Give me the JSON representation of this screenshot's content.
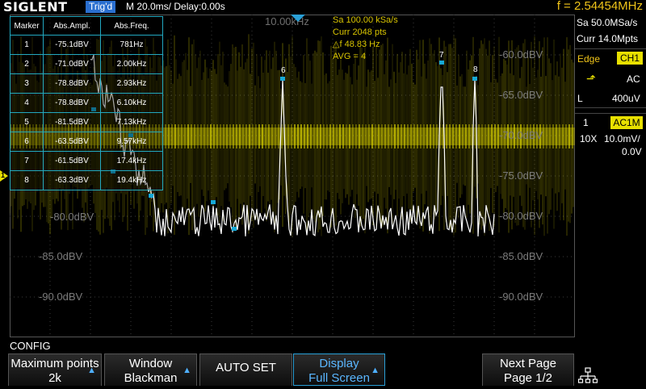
{
  "header": {
    "logo": "SIGLENT",
    "trigger_state": "Trig'd",
    "timebase": "M 20.0ms/ Delay:0.00s",
    "frequency": "f = 2.54454MHz"
  },
  "plot": {
    "center_freq_label": "10.00kHz",
    "levels_left": [
      "-80.0dBV",
      "-85.0dBV",
      "-90.0dBV"
    ],
    "levels_right": [
      "-60.0dBV",
      "-65.0dBV",
      "-70.0dBV",
      "-75.0dBV",
      "-80.0dBV",
      "-85.0dBV",
      "-90.0dBV"
    ],
    "channel_marker": "1",
    "peak_labels": [
      "6",
      "7",
      "8"
    ]
  },
  "info": {
    "sample_rate": "Sa 100.00 kSa/s",
    "current_points": "Curr 2048 pts",
    "delta_f": "△f 48.83 Hz",
    "avg": "AVG = 4"
  },
  "marker_table": {
    "headers": [
      "Marker",
      "Abs.Ampl.",
      "Abs.Freq."
    ],
    "rows": [
      [
        "1",
        "-75.1dBV",
        "781Hz"
      ],
      [
        "2",
        "-71.0dBV",
        "2.00kHz"
      ],
      [
        "3",
        "-78.8dBV",
        "2.93kHz"
      ],
      [
        "4",
        "-78.8dBV",
        "6.10kHz"
      ],
      [
        "5",
        "-81.5dBV",
        "7.13kHz"
      ],
      [
        "6",
        "-63.5dBV",
        "9.57kHz"
      ],
      [
        "7",
        "-61.5dBV",
        "17.4kHz"
      ],
      [
        "8",
        "-63.3dBV",
        "19.4kHz"
      ]
    ]
  },
  "right_panel": {
    "sample_rate": "Sa 50.0MSa/s",
    "memory": "Curr 14.0Mpts",
    "trigger_type": "Edge",
    "trigger_source": "CH1",
    "coupling": "AC",
    "slope_level_label": "L",
    "trigger_level": "400uV",
    "channel_number": "1",
    "channel_coupling": "AC1M",
    "probe": "10X",
    "scale": "10.0mV/",
    "offset": "0.0V"
  },
  "menu": {
    "title": "CONFIG",
    "softkeys": [
      {
        "line1": "Maximum points",
        "line2": "2k"
      },
      {
        "line1": "Window",
        "line2": "Blackman"
      },
      {
        "line1": "AUTO SET",
        "line2": ""
      },
      {
        "line1": "Display",
        "line2": "Full Screen"
      },
      {
        "line1": "Next Page",
        "line2": "Page 1/2"
      }
    ]
  },
  "colors": {
    "trace": "#ffffff",
    "ch1": "#e8e000",
    "accent": "#2a9fd6",
    "marker": "#17a9d6",
    "grid": "#3a3a3a"
  }
}
